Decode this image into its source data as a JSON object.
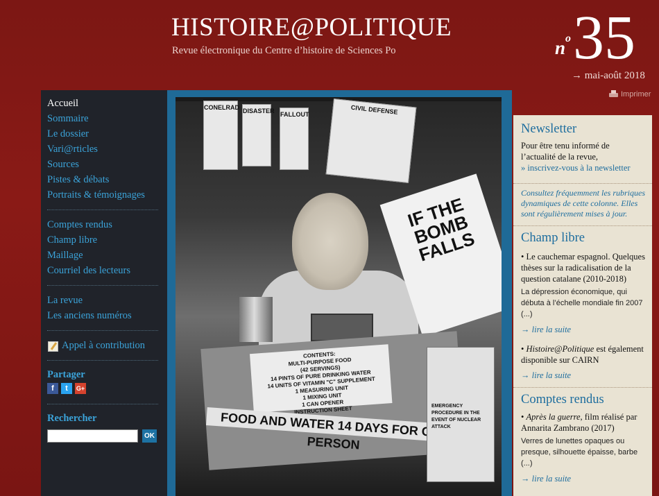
{
  "header": {
    "title": "HISTOIRE@POLITIQUE",
    "subtitle": "Revue électronique du Centre d’histoire de Sciences Po",
    "issue_prefix": "n",
    "issue_sup": "o",
    "issue_number": "35",
    "issue_date": "→ mai-août 2018",
    "print_label": "Imprimer"
  },
  "sidebar": {
    "group1": [
      "Accueil",
      "Sommaire",
      "Le dossier",
      "Vari@rticles",
      "Sources",
      "Pistes & débats",
      "Portraits & témoignages"
    ],
    "group2": [
      "Comptes rendus",
      "Champ libre",
      "Maillage",
      "Courriel des lecteurs"
    ],
    "group3": [
      "La revue",
      "Les anciens numéros"
    ],
    "contribution": "Appel à contribution",
    "share_title": "Partager",
    "share": {
      "fb": "f",
      "tw": "t",
      "gp": "G+"
    },
    "search_title": "Rechercher",
    "search_value": "",
    "search_button": "OK"
  },
  "photo": {
    "pamphlets": [
      "CONELRAD",
      "DISASTER",
      "FALLOUT",
      "CIVIL DEFENSE"
    ],
    "poster": "IF THE BOMB FALLS",
    "crate_label": "CONTENTS:\nMULTI-PURPOSE FOOD\n(42 SERVINGS)\n14 PINTS OF PURE DRINKING WATER\n14 UNITS OF VITAMIN \"C\" SUPPLEMENT\n1 MEASURING UNIT\n1 MIXING UNIT\n1 CAN OPENER\nINSTRUCTION SHEET",
    "crate_stripe": "FOOD AND WATER  14 DAYS  FOR ONE PERSON",
    "booklet": "EMERGENCY PROCEDURE IN THE EVENT OF NUCLEAR ATTACK"
  },
  "right": {
    "newsletter_title": "Newsletter",
    "newsletter_text": "Pour être tenu informé de l’actualité de la revue,",
    "newsletter_link": "» inscrivez-vous à la newsletter",
    "notice": "Consultez fréquemment les rubriques dynamiques de cette colonne. Elles sont régulièrement mises à jour.",
    "champ_title": "Champ libre",
    "champ_item1_title": "• Le cauchemar espagnol. Quelques thèses sur la radicalisation de la question catalane (2010-2018)",
    "champ_item1_desc": "La dépression économique, qui débuta à l’échelle mondiale fin 2007 (...)",
    "more_label": "→ lire la suite",
    "champ_item2_prefix": "• ",
    "champ_item2_em": "Histoire@Politique",
    "champ_item2_rest": " est également disponible sur CAIRN",
    "cr_title": "Comptes rendus",
    "cr_item_prefix": "• ",
    "cr_item_em": "Après la guerre",
    "cr_item_rest": ", film réalisé par Annarita Zambrano (2017)",
    "cr_item_desc": "Verres de lunettes opaques ou presque, silhouette épaisse, barbe (...)"
  }
}
